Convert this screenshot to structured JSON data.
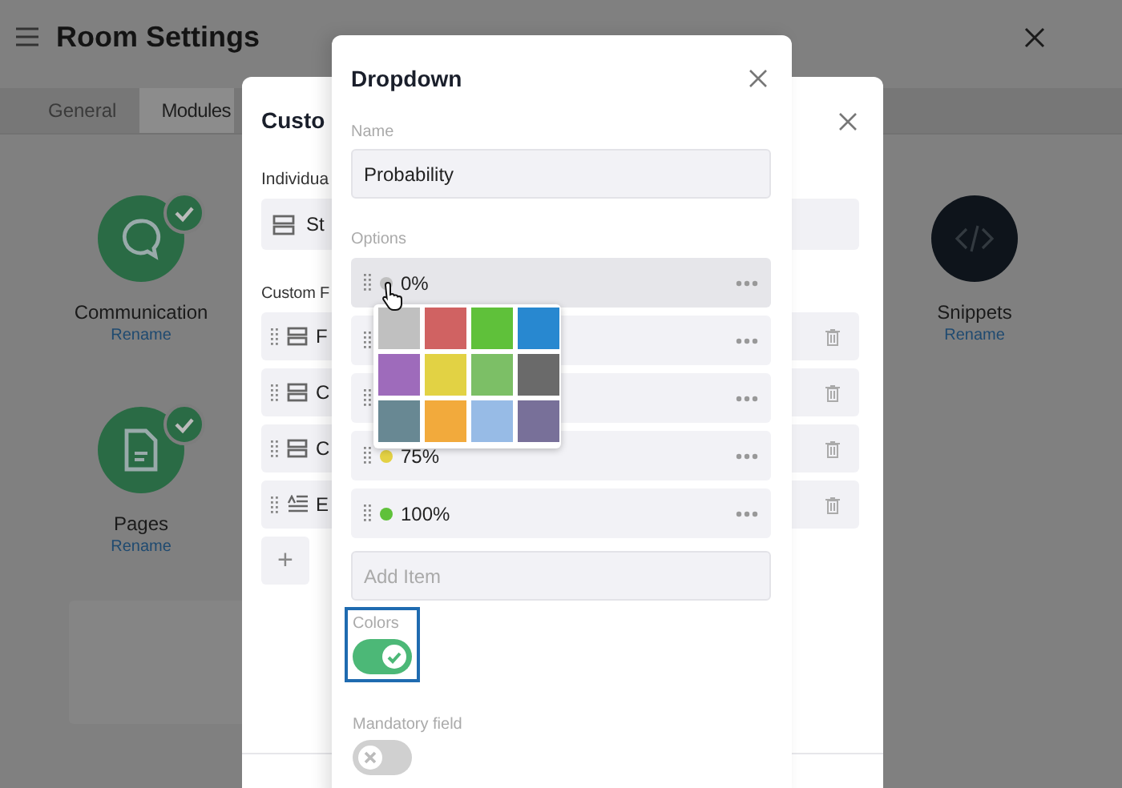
{
  "page": {
    "title": "Room Settings",
    "tabs": [
      {
        "label": "General",
        "selected": false
      },
      {
        "label": "Modules",
        "selected": true
      }
    ],
    "modules": [
      {
        "name": "Communication",
        "action": "Rename",
        "kind": "chat",
        "enabled": true
      },
      {
        "name": "Snippets",
        "action": "Rename",
        "kind": "code",
        "enabled": false
      },
      {
        "name": "Pages",
        "action": "Rename",
        "kind": "page",
        "enabled": true
      }
    ]
  },
  "custom_dialog": {
    "title": "Custo",
    "individual_label": "Individua",
    "individual_field": "St",
    "custom_label": "Custom F",
    "fields": [
      {
        "label": "F",
        "kind": "list"
      },
      {
        "label": "C",
        "kind": "list"
      },
      {
        "label": "C",
        "kind": "list"
      },
      {
        "label": "E",
        "kind": "text"
      }
    ],
    "add_button": "+"
  },
  "dropdown_dialog": {
    "title": "Dropdown",
    "name_label": "Name",
    "name_value": "Probability",
    "options_label": "Options",
    "options": [
      {
        "label": "0%",
        "color": "#c0c0c0",
        "hovered": true
      },
      {
        "hovered": false
      },
      {
        "hovered": false
      },
      {
        "label": "75%",
        "color": "#e3d144",
        "hovered": false
      },
      {
        "label": "100%",
        "color": "#5fc13a",
        "hovered": false
      }
    ],
    "color_picker": {
      "swatches": [
        {
          "color": "#c0c0c0"
        },
        {
          "color": "#d06262"
        },
        {
          "color": "#5fc13a"
        },
        {
          "color": "#2888d0"
        },
        {
          "color": "#9e6bbb"
        },
        {
          "color": "#e2d244"
        },
        {
          "color": "#7cbf66"
        },
        {
          "color": "#6a6a6a"
        },
        {
          "color": "#688893"
        },
        {
          "color": "#f2aa3c"
        },
        {
          "color": "#97bbe6"
        },
        {
          "color": "#787099"
        }
      ]
    },
    "add_placeholder": "Add Item",
    "colors": {
      "label": "Colors",
      "on": true,
      "focused": true
    },
    "mandatory": {
      "label": "Mandatory field",
      "on": false
    }
  }
}
